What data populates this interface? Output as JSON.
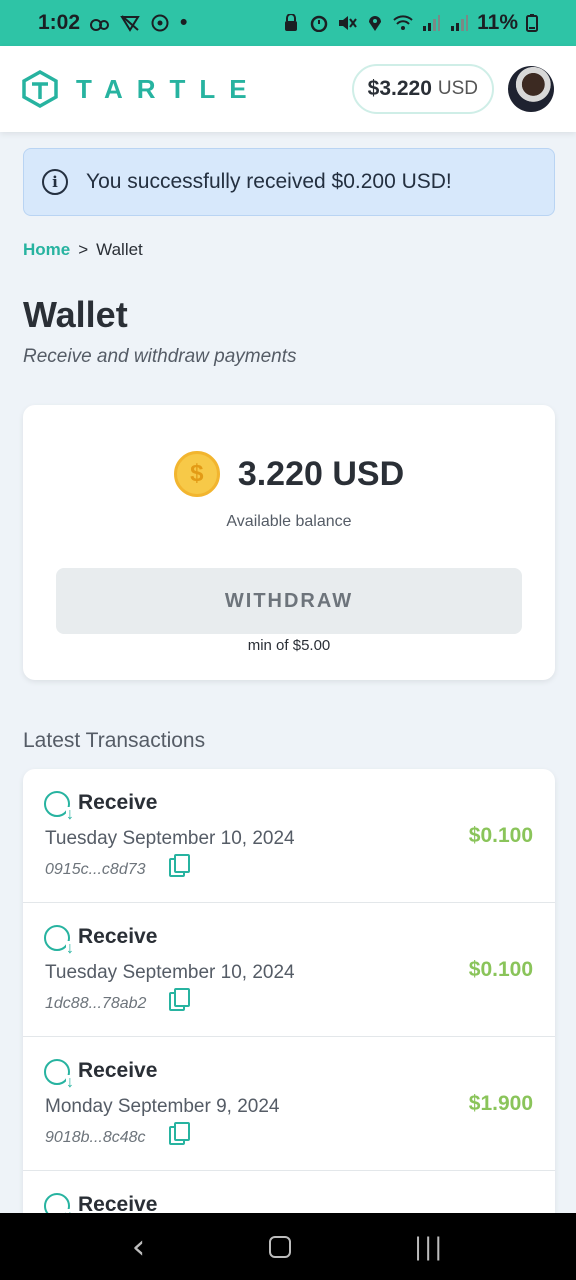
{
  "status_bar": {
    "time": "1:02",
    "battery": "11%",
    "dot": "•"
  },
  "header": {
    "logo_text": "TARTLE",
    "balance_amount": "$3.220",
    "balance_currency": "USD"
  },
  "alert": {
    "message": "You successfully received $0.200 USD!"
  },
  "breadcrumb": {
    "home": "Home",
    "separator": ">",
    "current": "Wallet"
  },
  "page": {
    "title": "Wallet",
    "subtitle": "Receive and withdraw payments"
  },
  "wallet": {
    "balance": "3.220 USD",
    "balance_label": "Available balance",
    "coin_symbol": "$",
    "withdraw_label": "WITHDRAW",
    "min_note": "min of $5.00"
  },
  "transactions": {
    "title": "Latest Transactions",
    "items": [
      {
        "type": "Receive",
        "date": "Tuesday September 10, 2024",
        "hash": "0915c...c8d73",
        "amount": "$0.100"
      },
      {
        "type": "Receive",
        "date": "Tuesday September 10, 2024",
        "hash": "1dc88...78ab2",
        "amount": "$0.100"
      },
      {
        "type": "Receive",
        "date": "Monday September 9, 2024",
        "hash": "9018b...8c48c",
        "amount": "$1.900"
      },
      {
        "type": "Receive",
        "date": "",
        "hash": "",
        "amount": ""
      }
    ]
  },
  "colors": {
    "accent": "#27b3a0",
    "status_bar": "#2ec4a6",
    "amount_green": "#8ac45a",
    "alert_bg": "#d7e8fb"
  },
  "nav": {
    "back": "‹",
    "recent": "|||"
  }
}
